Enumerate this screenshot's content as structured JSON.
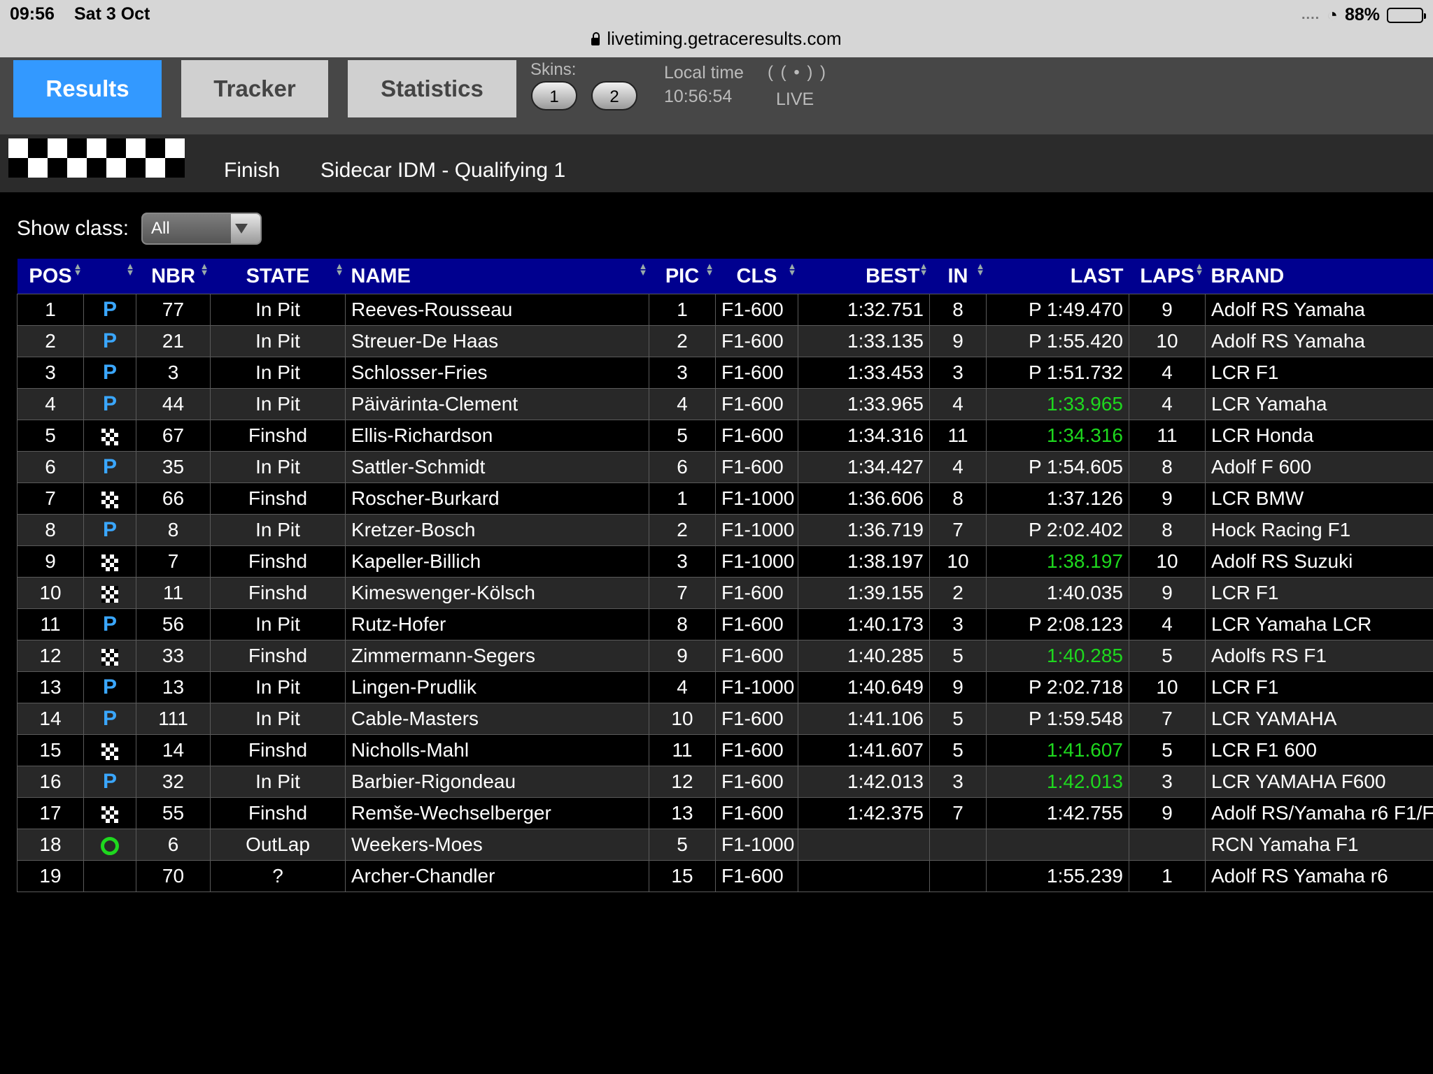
{
  "status_bar": {
    "time": "09:56",
    "date": "Sat 3 Oct",
    "signal": "....",
    "wifi_icon": "wifi-icon",
    "battery_percent": "88%",
    "battery_level": 0.88
  },
  "address_bar": {
    "url": "livetiming.getraceresults.com"
  },
  "nav": {
    "tabs": [
      {
        "label": "Results",
        "active": true
      },
      {
        "label": "Tracker",
        "active": false
      },
      {
        "label": "Statistics",
        "active": false
      }
    ],
    "skins_label": "Skins:",
    "skins": [
      "1",
      "2"
    ],
    "local_time_label": "Local time",
    "local_time": "10:56:54",
    "live_icon": "( ( • ) )",
    "live_label": "LIVE"
  },
  "race": {
    "state": "Finish",
    "title": "Sidecar IDM - Qualifying 1"
  },
  "filter": {
    "label": "Show class:",
    "selected": "All"
  },
  "table": {
    "headers": {
      "pos": "POS",
      "status": "",
      "nbr": "NBR",
      "state": "STATE",
      "name": "NAME",
      "pic": "PIC",
      "cls": "CLS",
      "best": "BEST",
      "in": "IN",
      "last": "LAST",
      "laps": "LAPS",
      "brand": "BRAND"
    },
    "rows": [
      {
        "pos": "1",
        "status": "pit",
        "nbr": "77",
        "state": "In Pit",
        "name": "Reeves-Rousseau",
        "pic": "1",
        "cls": "F1-600",
        "best": "1:32.751",
        "in": "8",
        "last": "P 1:49.470",
        "last_best": false,
        "laps": "9",
        "brand": "Adolf RS Yamaha"
      },
      {
        "pos": "2",
        "status": "pit",
        "nbr": "21",
        "state": "In Pit",
        "name": "Streuer-De Haas",
        "pic": "2",
        "cls": "F1-600",
        "best": "1:33.135",
        "in": "9",
        "last": "P 1:55.420",
        "last_best": false,
        "laps": "10",
        "brand": "Adolf RS Yamaha"
      },
      {
        "pos": "3",
        "status": "pit",
        "nbr": "3",
        "state": "In Pit",
        "name": "Schlosser-Fries",
        "pic": "3",
        "cls": "F1-600",
        "best": "1:33.453",
        "in": "3",
        "last": "P 1:51.732",
        "last_best": false,
        "laps": "4",
        "brand": "LCR F1"
      },
      {
        "pos": "4",
        "status": "pit",
        "nbr": "44",
        "state": "In Pit",
        "name": "Päivärinta-Clement",
        "pic": "4",
        "cls": "F1-600",
        "best": "1:33.965",
        "in": "4",
        "last": "1:33.965",
        "last_best": true,
        "laps": "4",
        "brand": "LCR Yamaha"
      },
      {
        "pos": "5",
        "status": "finish",
        "nbr": "67",
        "state": "Finshd",
        "name": "Ellis-Richardson",
        "pic": "5",
        "cls": "F1-600",
        "best": "1:34.316",
        "in": "11",
        "last": "1:34.316",
        "last_best": true,
        "laps": "11",
        "brand": "LCR Honda"
      },
      {
        "pos": "6",
        "status": "pit",
        "nbr": "35",
        "state": "In Pit",
        "name": "Sattler-Schmidt",
        "pic": "6",
        "cls": "F1-600",
        "best": "1:34.427",
        "in": "4",
        "last": "P 1:54.605",
        "last_best": false,
        "laps": "8",
        "brand": "Adolf F 600"
      },
      {
        "pos": "7",
        "status": "finish",
        "nbr": "66",
        "state": "Finshd",
        "name": "Roscher-Burkard",
        "pic": "1",
        "cls": "F1-1000",
        "best": "1:36.606",
        "in": "8",
        "last": "1:37.126",
        "last_best": false,
        "laps": "9",
        "brand": "LCR BMW"
      },
      {
        "pos": "8",
        "status": "pit",
        "nbr": "8",
        "state": "In Pit",
        "name": "Kretzer-Bosch",
        "pic": "2",
        "cls": "F1-1000",
        "best": "1:36.719",
        "in": "7",
        "last": "P 2:02.402",
        "last_best": false,
        "laps": "8",
        "brand": "Hock Racing F1"
      },
      {
        "pos": "9",
        "status": "finish",
        "nbr": "7",
        "state": "Finshd",
        "name": "Kapeller-Billich",
        "pic": "3",
        "cls": "F1-1000",
        "best": "1:38.197",
        "in": "10",
        "last": "1:38.197",
        "last_best": true,
        "laps": "10",
        "brand": "Adolf RS Suzuki"
      },
      {
        "pos": "10",
        "status": "finish",
        "nbr": "11",
        "state": "Finshd",
        "name": "Kimeswenger-Kölsch",
        "pic": "7",
        "cls": "F1-600",
        "best": "1:39.155",
        "in": "2",
        "last": "1:40.035",
        "last_best": false,
        "laps": "9",
        "brand": "LCR F1"
      },
      {
        "pos": "11",
        "status": "pit",
        "nbr": "56",
        "state": "In Pit",
        "name": "Rutz-Hofer",
        "pic": "8",
        "cls": "F1-600",
        "best": "1:40.173",
        "in": "3",
        "last": "P 2:08.123",
        "last_best": false,
        "laps": "4",
        "brand": "LCR Yamaha LCR"
      },
      {
        "pos": "12",
        "status": "finish",
        "nbr": "33",
        "state": "Finshd",
        "name": "Zimmermann-Segers",
        "pic": "9",
        "cls": "F1-600",
        "best": "1:40.285",
        "in": "5",
        "last": "1:40.285",
        "last_best": true,
        "laps": "5",
        "brand": "Adolfs RS F1"
      },
      {
        "pos": "13",
        "status": "pit",
        "nbr": "13",
        "state": "In Pit",
        "name": "Lingen-Prudlik",
        "pic": "4",
        "cls": "F1-1000",
        "best": "1:40.649",
        "in": "9",
        "last": "P 2:02.718",
        "last_best": false,
        "laps": "10",
        "brand": "LCR F1"
      },
      {
        "pos": "14",
        "status": "pit",
        "nbr": "111",
        "state": "In Pit",
        "name": "Cable-Masters",
        "pic": "10",
        "cls": "F1-600",
        "best": "1:41.106",
        "in": "5",
        "last": "P 1:59.548",
        "last_best": false,
        "laps": "7",
        "brand": "LCR YAMAHA"
      },
      {
        "pos": "15",
        "status": "finish",
        "nbr": "14",
        "state": "Finshd",
        "name": "Nicholls-Mahl",
        "pic": "11",
        "cls": "F1-600",
        "best": "1:41.607",
        "in": "5",
        "last": "1:41.607",
        "last_best": true,
        "laps": "5",
        "brand": "LCR F1 600"
      },
      {
        "pos": "16",
        "status": "pit",
        "nbr": "32",
        "state": "In Pit",
        "name": "Barbier-Rigondeau",
        "pic": "12",
        "cls": "F1-600",
        "best": "1:42.013",
        "in": "3",
        "last": "1:42.013",
        "last_best": true,
        "laps": "3",
        "brand": "LCR YAMAHA F600"
      },
      {
        "pos": "17",
        "status": "finish",
        "nbr": "55",
        "state": "Finshd",
        "name": "Remše-Wechselberger",
        "pic": "13",
        "cls": "F1-600",
        "best": "1:42.375",
        "in": "7",
        "last": "1:42.755",
        "last_best": false,
        "laps": "9",
        "brand": "Adolf RS/Yamaha r6 F1/F"
      },
      {
        "pos": "18",
        "status": "outlap",
        "nbr": "6",
        "state": "OutLap",
        "name": "Weekers-Moes",
        "pic": "5",
        "cls": "F1-1000",
        "best": "",
        "in": "",
        "last": "",
        "last_best": false,
        "laps": "",
        "brand": "RCN Yamaha F1"
      },
      {
        "pos": "19",
        "status": "",
        "nbr": "70",
        "state": "?",
        "name": "Archer-Chandler",
        "pic": "15",
        "cls": "F1-600",
        "best": "",
        "in": "",
        "last": "1:55.239",
        "last_best": false,
        "laps": "1",
        "brand": "Adolf RS Yamaha r6"
      }
    ]
  },
  "status_icons": {
    "pit": "P",
    "finish": "finish-flag-icon",
    "outlap": "outlap-ring-icon"
  },
  "colors": {
    "active_tab": "#3399ff",
    "header_bg": "#00008f",
    "pit_icon": "#3aa7ff",
    "best_lap": "#1ed81e"
  }
}
